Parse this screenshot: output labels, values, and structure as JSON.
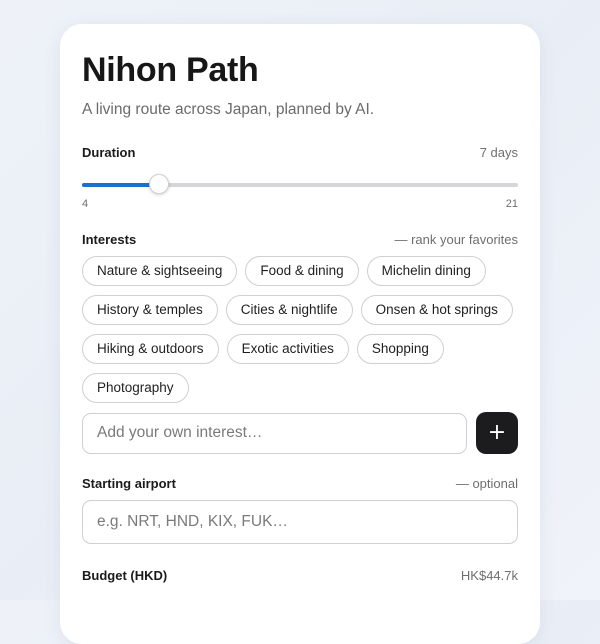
{
  "app": {
    "title": "Nihon Path",
    "subtitle": "A living route across Japan, planned by AI."
  },
  "duration": {
    "label": "Duration",
    "value_text": "7 days",
    "value": 7,
    "min": 4,
    "max": 21,
    "min_label": "4",
    "max_label": "21",
    "accent_color": "#1f6fd1"
  },
  "interests": {
    "label": "Interests",
    "hint": "— rank your favorites",
    "chips": [
      "Nature & sightseeing",
      "Food & dining",
      "Michelin dining",
      "History & temples",
      "Cities & nightlife",
      "Onsen & hot springs",
      "Hiking & outdoors",
      "Exotic activities",
      "Shopping",
      "Photography"
    ],
    "custom_placeholder": "Add your own interest…",
    "add_icon": "plus-icon",
    "add_glyph": "+"
  },
  "airport": {
    "label": "Starting airport",
    "hint": "— optional",
    "placeholder": "e.g. NRT, HND, KIX, FUK…"
  },
  "budget": {
    "label": "Budget (HKD)",
    "value_text": "HK$44.7k"
  }
}
